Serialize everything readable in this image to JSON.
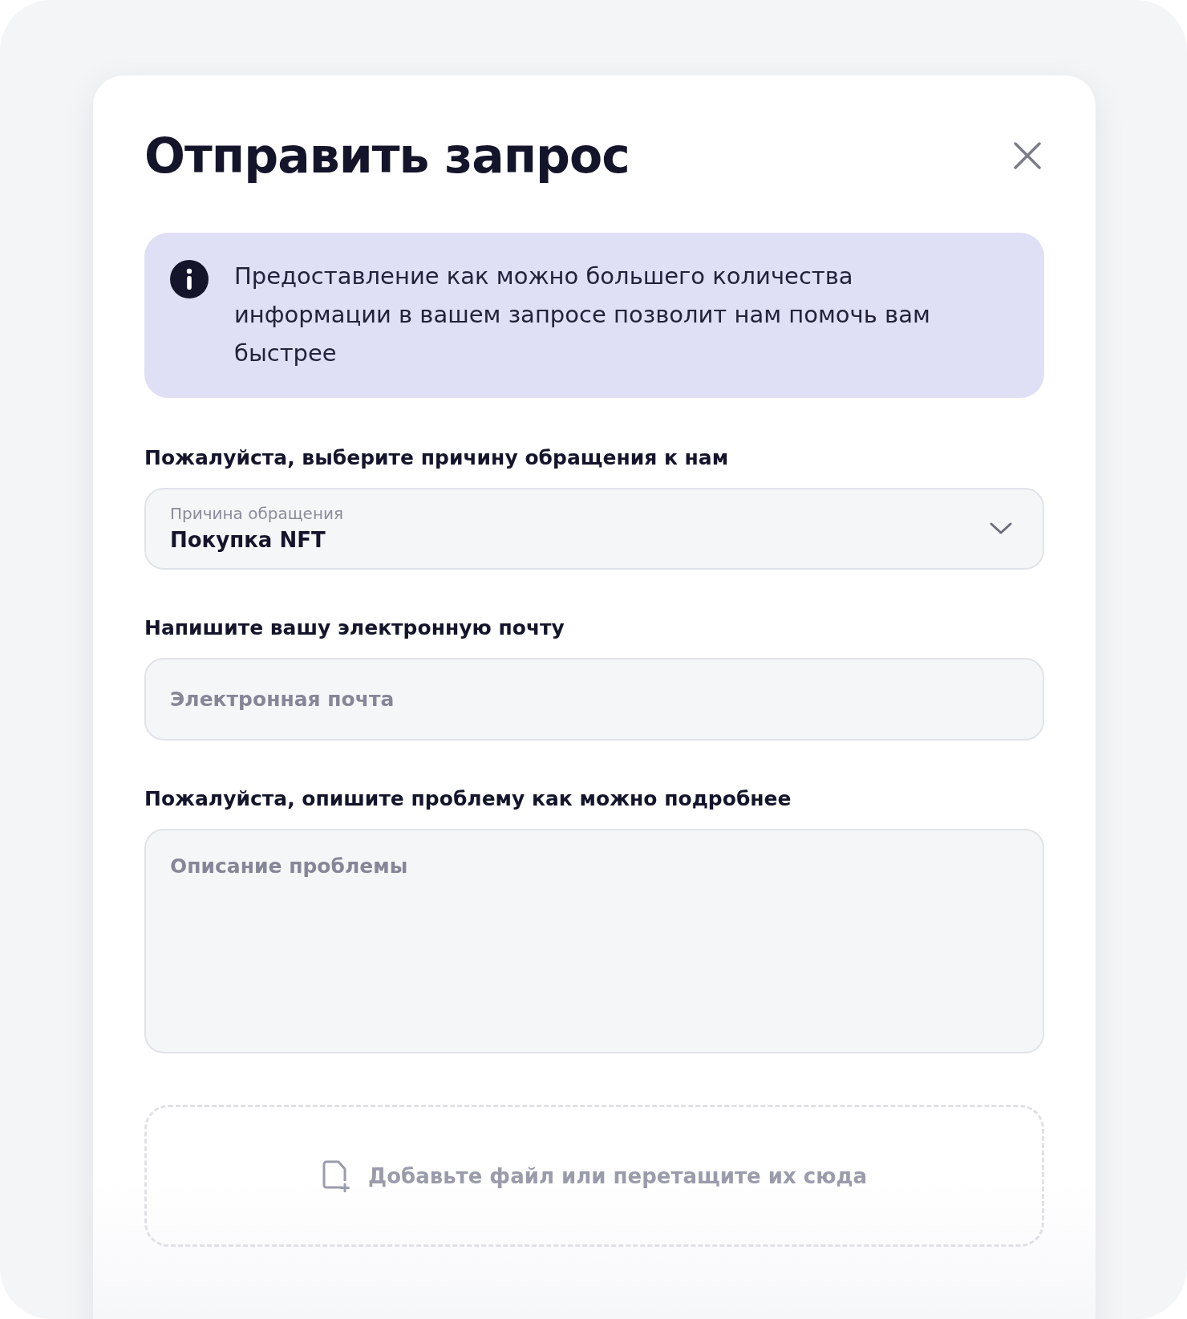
{
  "dialog": {
    "title": "Отправить запрос"
  },
  "notice": {
    "text": "Предоставление как можно большего количества информации в вашем запросе позволит нам помочь вам быстрее"
  },
  "reason": {
    "label": "Пожалуйста, выберите причину обращения к нам",
    "floating_label": "Причина обращения",
    "value": "Покупка NFT"
  },
  "email": {
    "label": "Напишите вашу электронную почту",
    "placeholder": "Электронная почта"
  },
  "description": {
    "label": "Пожалуйста, опишите проблему как можно подробнее",
    "placeholder": "Описание проблемы"
  },
  "upload": {
    "text": "Добавьте файл или перетащите их сюда"
  }
}
